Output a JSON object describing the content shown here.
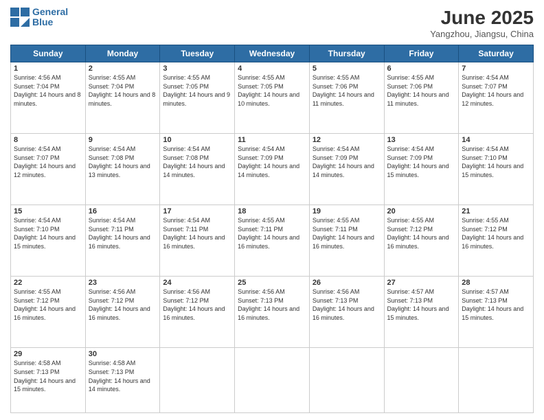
{
  "header": {
    "logo_line1": "General",
    "logo_line2": "Blue",
    "month": "June 2025",
    "location": "Yangzhou, Jiangsu, China"
  },
  "weekdays": [
    "Sunday",
    "Monday",
    "Tuesday",
    "Wednesday",
    "Thursday",
    "Friday",
    "Saturday"
  ],
  "weeks": [
    [
      {
        "day": "1",
        "sunrise": "Sunrise: 4:56 AM",
        "sunset": "Sunset: 7:04 PM",
        "daylight": "Daylight: 14 hours and 8 minutes."
      },
      {
        "day": "2",
        "sunrise": "Sunrise: 4:55 AM",
        "sunset": "Sunset: 7:04 PM",
        "daylight": "Daylight: 14 hours and 8 minutes."
      },
      {
        "day": "3",
        "sunrise": "Sunrise: 4:55 AM",
        "sunset": "Sunset: 7:05 PM",
        "daylight": "Daylight: 14 hours and 9 minutes."
      },
      {
        "day": "4",
        "sunrise": "Sunrise: 4:55 AM",
        "sunset": "Sunset: 7:05 PM",
        "daylight": "Daylight: 14 hours and 10 minutes."
      },
      {
        "day": "5",
        "sunrise": "Sunrise: 4:55 AM",
        "sunset": "Sunset: 7:06 PM",
        "daylight": "Daylight: 14 hours and 11 minutes."
      },
      {
        "day": "6",
        "sunrise": "Sunrise: 4:55 AM",
        "sunset": "Sunset: 7:06 PM",
        "daylight": "Daylight: 14 hours and 11 minutes."
      },
      {
        "day": "7",
        "sunrise": "Sunrise: 4:54 AM",
        "sunset": "Sunset: 7:07 PM",
        "daylight": "Daylight: 14 hours and 12 minutes."
      }
    ],
    [
      {
        "day": "8",
        "sunrise": "Sunrise: 4:54 AM",
        "sunset": "Sunset: 7:07 PM",
        "daylight": "Daylight: 14 hours and 12 minutes."
      },
      {
        "day": "9",
        "sunrise": "Sunrise: 4:54 AM",
        "sunset": "Sunset: 7:08 PM",
        "daylight": "Daylight: 14 hours and 13 minutes."
      },
      {
        "day": "10",
        "sunrise": "Sunrise: 4:54 AM",
        "sunset": "Sunset: 7:08 PM",
        "daylight": "Daylight: 14 hours and 14 minutes."
      },
      {
        "day": "11",
        "sunrise": "Sunrise: 4:54 AM",
        "sunset": "Sunset: 7:09 PM",
        "daylight": "Daylight: 14 hours and 14 minutes."
      },
      {
        "day": "12",
        "sunrise": "Sunrise: 4:54 AM",
        "sunset": "Sunset: 7:09 PM",
        "daylight": "Daylight: 14 hours and 14 minutes."
      },
      {
        "day": "13",
        "sunrise": "Sunrise: 4:54 AM",
        "sunset": "Sunset: 7:09 PM",
        "daylight": "Daylight: 14 hours and 15 minutes."
      },
      {
        "day": "14",
        "sunrise": "Sunrise: 4:54 AM",
        "sunset": "Sunset: 7:10 PM",
        "daylight": "Daylight: 14 hours and 15 minutes."
      }
    ],
    [
      {
        "day": "15",
        "sunrise": "Sunrise: 4:54 AM",
        "sunset": "Sunset: 7:10 PM",
        "daylight": "Daylight: 14 hours and 15 minutes."
      },
      {
        "day": "16",
        "sunrise": "Sunrise: 4:54 AM",
        "sunset": "Sunset: 7:11 PM",
        "daylight": "Daylight: 14 hours and 16 minutes."
      },
      {
        "day": "17",
        "sunrise": "Sunrise: 4:54 AM",
        "sunset": "Sunset: 7:11 PM",
        "daylight": "Daylight: 14 hours and 16 minutes."
      },
      {
        "day": "18",
        "sunrise": "Sunrise: 4:55 AM",
        "sunset": "Sunset: 7:11 PM",
        "daylight": "Daylight: 14 hours and 16 minutes."
      },
      {
        "day": "19",
        "sunrise": "Sunrise: 4:55 AM",
        "sunset": "Sunset: 7:11 PM",
        "daylight": "Daylight: 14 hours and 16 minutes."
      },
      {
        "day": "20",
        "sunrise": "Sunrise: 4:55 AM",
        "sunset": "Sunset: 7:12 PM",
        "daylight": "Daylight: 14 hours and 16 minutes."
      },
      {
        "day": "21",
        "sunrise": "Sunrise: 4:55 AM",
        "sunset": "Sunset: 7:12 PM",
        "daylight": "Daylight: 14 hours and 16 minutes."
      }
    ],
    [
      {
        "day": "22",
        "sunrise": "Sunrise: 4:55 AM",
        "sunset": "Sunset: 7:12 PM",
        "daylight": "Daylight: 14 hours and 16 minutes."
      },
      {
        "day": "23",
        "sunrise": "Sunrise: 4:56 AM",
        "sunset": "Sunset: 7:12 PM",
        "daylight": "Daylight: 14 hours and 16 minutes."
      },
      {
        "day": "24",
        "sunrise": "Sunrise: 4:56 AM",
        "sunset": "Sunset: 7:12 PM",
        "daylight": "Daylight: 14 hours and 16 minutes."
      },
      {
        "day": "25",
        "sunrise": "Sunrise: 4:56 AM",
        "sunset": "Sunset: 7:13 PM",
        "daylight": "Daylight: 14 hours and 16 minutes."
      },
      {
        "day": "26",
        "sunrise": "Sunrise: 4:56 AM",
        "sunset": "Sunset: 7:13 PM",
        "daylight": "Daylight: 14 hours and 16 minutes."
      },
      {
        "day": "27",
        "sunrise": "Sunrise: 4:57 AM",
        "sunset": "Sunset: 7:13 PM",
        "daylight": "Daylight: 14 hours and 15 minutes."
      },
      {
        "day": "28",
        "sunrise": "Sunrise: 4:57 AM",
        "sunset": "Sunset: 7:13 PM",
        "daylight": "Daylight: 14 hours and 15 minutes."
      }
    ],
    [
      {
        "day": "29",
        "sunrise": "Sunrise: 4:58 AM",
        "sunset": "Sunset: 7:13 PM",
        "daylight": "Daylight: 14 hours and 15 minutes."
      },
      {
        "day": "30",
        "sunrise": "Sunrise: 4:58 AM",
        "sunset": "Sunset: 7:13 PM",
        "daylight": "Daylight: 14 hours and 14 minutes."
      },
      null,
      null,
      null,
      null,
      null
    ]
  ]
}
